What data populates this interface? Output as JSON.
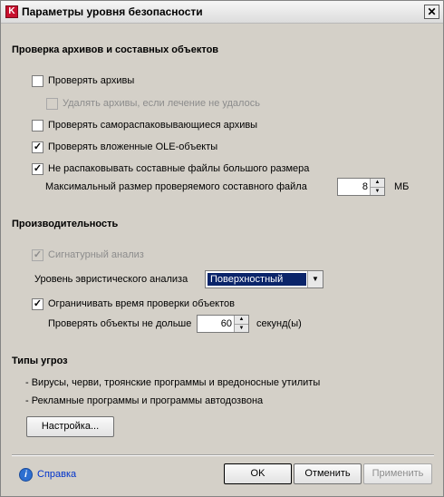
{
  "window": {
    "title": "Параметры уровня безопасности",
    "app_icon_glyph": "K",
    "close_glyph": "✕"
  },
  "archives": {
    "section_title": "Проверка архивов и составных объектов",
    "items": [
      {
        "label": "Проверять архивы",
        "checked": false,
        "enabled": true
      },
      {
        "label": "Удалять архивы, если лечение не удалось",
        "checked": false,
        "enabled": false
      },
      {
        "label": "Проверять самораспаковывающиеся архивы",
        "checked": false,
        "enabled": true
      },
      {
        "label": "Проверять вложенные OLE-объекты",
        "checked": true,
        "enabled": true
      },
      {
        "label": "Не распаковывать составные файлы большого размера",
        "checked": true,
        "enabled": true
      }
    ],
    "max_size_label": "Максимальный размер проверяемого составного файла",
    "max_size_value": "8",
    "max_size_unit": "МБ"
  },
  "performance": {
    "section_title": "Производительность",
    "signature_label": "Сигнатурный анализ",
    "signature_checked": true,
    "heuristic_label": "Уровень эвристического анализа",
    "heuristic_value": "Поверхностный",
    "limit_time_label": "Ограничивать время проверки объектов",
    "limit_time_checked": true,
    "check_no_longer_label": "Проверять объекты не дольше",
    "time_value": "60",
    "time_unit": "секунд(ы)"
  },
  "threats": {
    "section_title": "Типы угроз",
    "items": [
      "- Вирусы, черви, троянские программы и вредоносные утилиты",
      "- Рекламные программы и программы автодозвона"
    ],
    "settings_button": "Настройка..."
  },
  "footer": {
    "help_link": "Справка",
    "help_glyph": "i",
    "ok": "OK",
    "cancel": "Отменить",
    "apply": "Применить"
  },
  "glyphs": {
    "check": "✓",
    "spin_up": "▲",
    "spin_down": "▼",
    "dropdown": "▼"
  },
  "colors": {
    "selection": "#0a246a",
    "link": "#0033cc",
    "disabled_text": "#8c8c8c"
  }
}
